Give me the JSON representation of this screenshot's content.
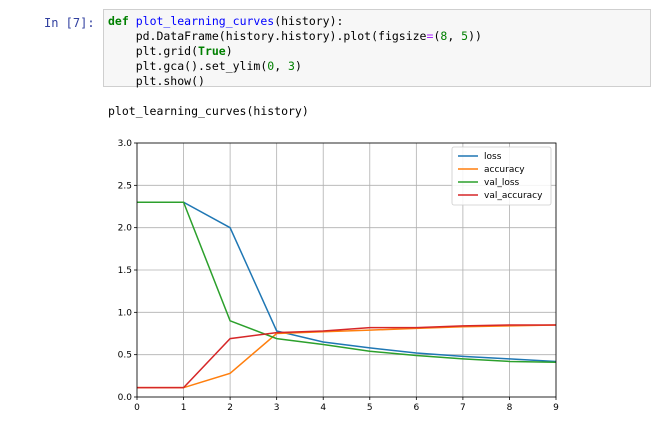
{
  "cell": {
    "prompt": "In  [7]:",
    "code_lines": [
      "def plot_learning_curves(history):",
      "    pd.DataFrame(history.history).plot(figsize=(8, 5))",
      "    plt.grid(True)",
      "    plt.gca().set_ylim(0, 3)",
      "    plt.show()",
      "",
      "plot_learning_curves(history)"
    ]
  },
  "chart_data": {
    "type": "line",
    "x": [
      0,
      1,
      2,
      3,
      4,
      5,
      6,
      7,
      8,
      9
    ],
    "xlim": [
      0,
      9
    ],
    "ylim": [
      0,
      3
    ],
    "x_ticks": [
      "0",
      "1",
      "2",
      "3",
      "4",
      "5",
      "6",
      "7",
      "8",
      "9"
    ],
    "y_ticks": [
      "0.0",
      "0.5",
      "1.0",
      "1.5",
      "2.0",
      "2.5",
      "3.0"
    ],
    "grid": true,
    "legend_position": "top-right",
    "series": [
      {
        "name": "loss",
        "color": "#1f77b4",
        "values": [
          2.3,
          2.3,
          2.0,
          0.78,
          0.65,
          0.58,
          0.52,
          0.48,
          0.45,
          0.42
        ]
      },
      {
        "name": "accuracy",
        "color": "#ff7f0e",
        "values": [
          0.11,
          0.11,
          0.28,
          0.75,
          0.77,
          0.79,
          0.81,
          0.83,
          0.84,
          0.85
        ]
      },
      {
        "name": "val_loss",
        "color": "#2ca02c",
        "values": [
          2.3,
          2.3,
          0.9,
          0.69,
          0.62,
          0.54,
          0.49,
          0.45,
          0.42,
          0.41
        ]
      },
      {
        "name": "val_accuracy",
        "color": "#d62728",
        "values": [
          0.11,
          0.11,
          0.69,
          0.76,
          0.78,
          0.82,
          0.82,
          0.84,
          0.85,
          0.85
        ]
      }
    ]
  }
}
